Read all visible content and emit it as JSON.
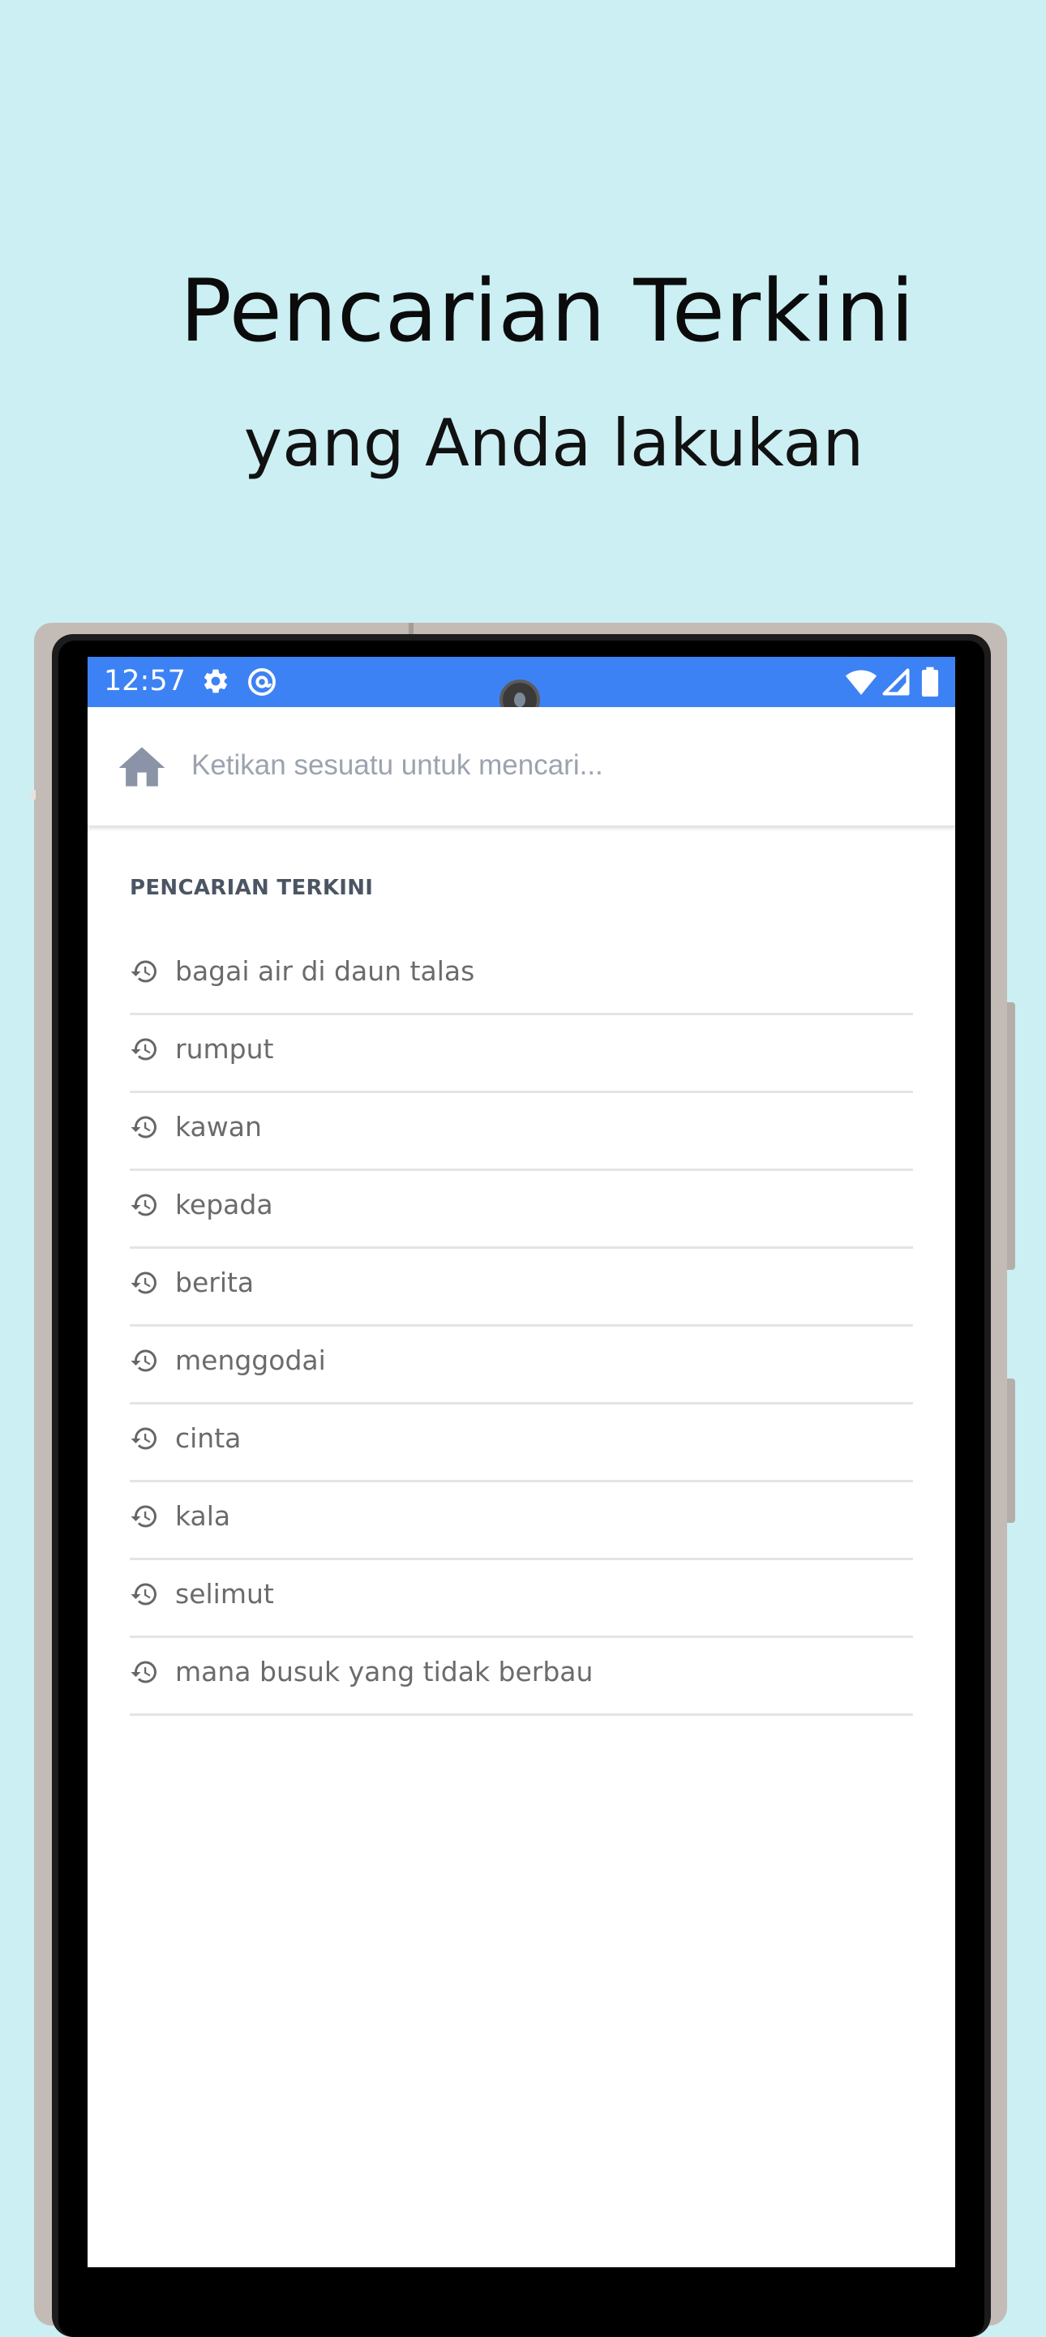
{
  "promo": {
    "title": "Pencarian Terkini",
    "subtitle": "yang Anda lakukan"
  },
  "status_bar": {
    "time": "12:57",
    "left_icons": [
      "gear-icon",
      "at-sign-icon"
    ],
    "right_icons": [
      "wifi-icon",
      "signal-icon",
      "battery-icon"
    ],
    "color": "#3d82f4"
  },
  "search": {
    "placeholder": "Ketikan sesuatu untuk mencari...",
    "value": ""
  },
  "recent": {
    "title": "PENCARIAN TERKINI",
    "items": [
      {
        "label": "bagai air di daun talas",
        "icon": "history-icon"
      },
      {
        "label": "rumput",
        "icon": "history-icon"
      },
      {
        "label": "kawan",
        "icon": "history-icon"
      },
      {
        "label": "kepada",
        "icon": "history-icon"
      },
      {
        "label": "berita",
        "icon": "history-icon"
      },
      {
        "label": "menggodai",
        "icon": "history-icon"
      },
      {
        "label": "cinta",
        "icon": "history-icon"
      },
      {
        "label": "kala",
        "icon": "history-icon"
      },
      {
        "label": "selimut",
        "icon": "history-icon"
      },
      {
        "label": "mana busuk yang tidak berbau",
        "icon": "history-icon"
      }
    ]
  },
  "colors": {
    "background": "#cbeff3",
    "accent": "#3d82f4",
    "icon_gray": "#8a94a6"
  }
}
